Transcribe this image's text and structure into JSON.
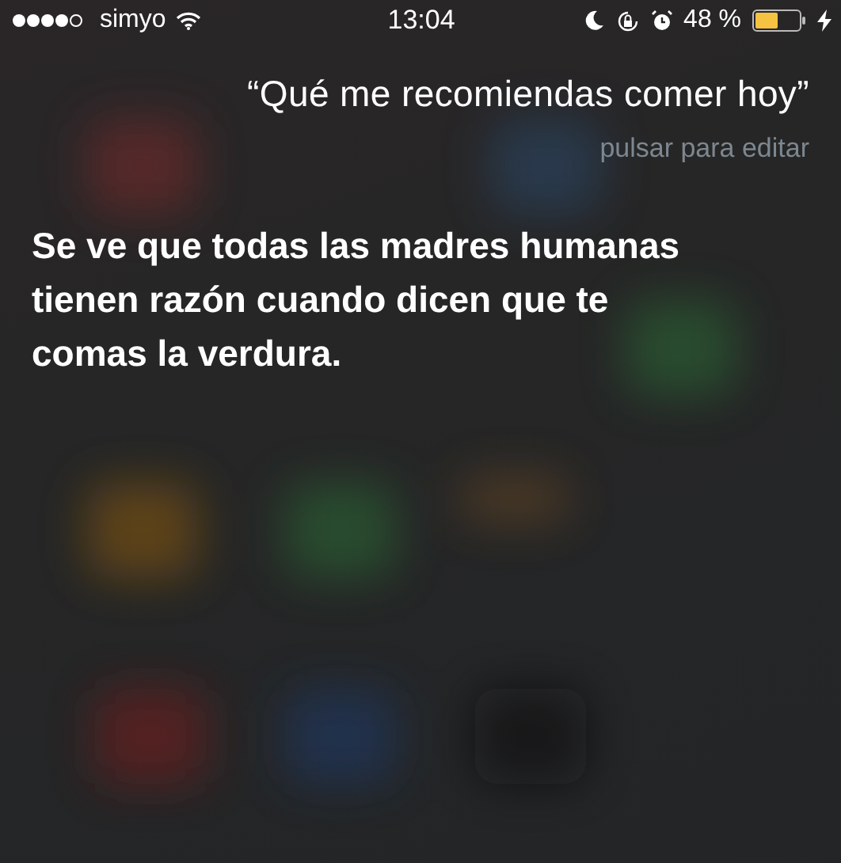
{
  "status_bar": {
    "carrier": "simyo",
    "time": "13:04",
    "battery_percent": "48 %"
  },
  "query": {
    "text": "“Qué me recomiendas comer hoy”",
    "hint": "pulsar para editar"
  },
  "answer": "Se ve que todas las madres humanas tienen razón cuando dicen que te comas la verdura."
}
